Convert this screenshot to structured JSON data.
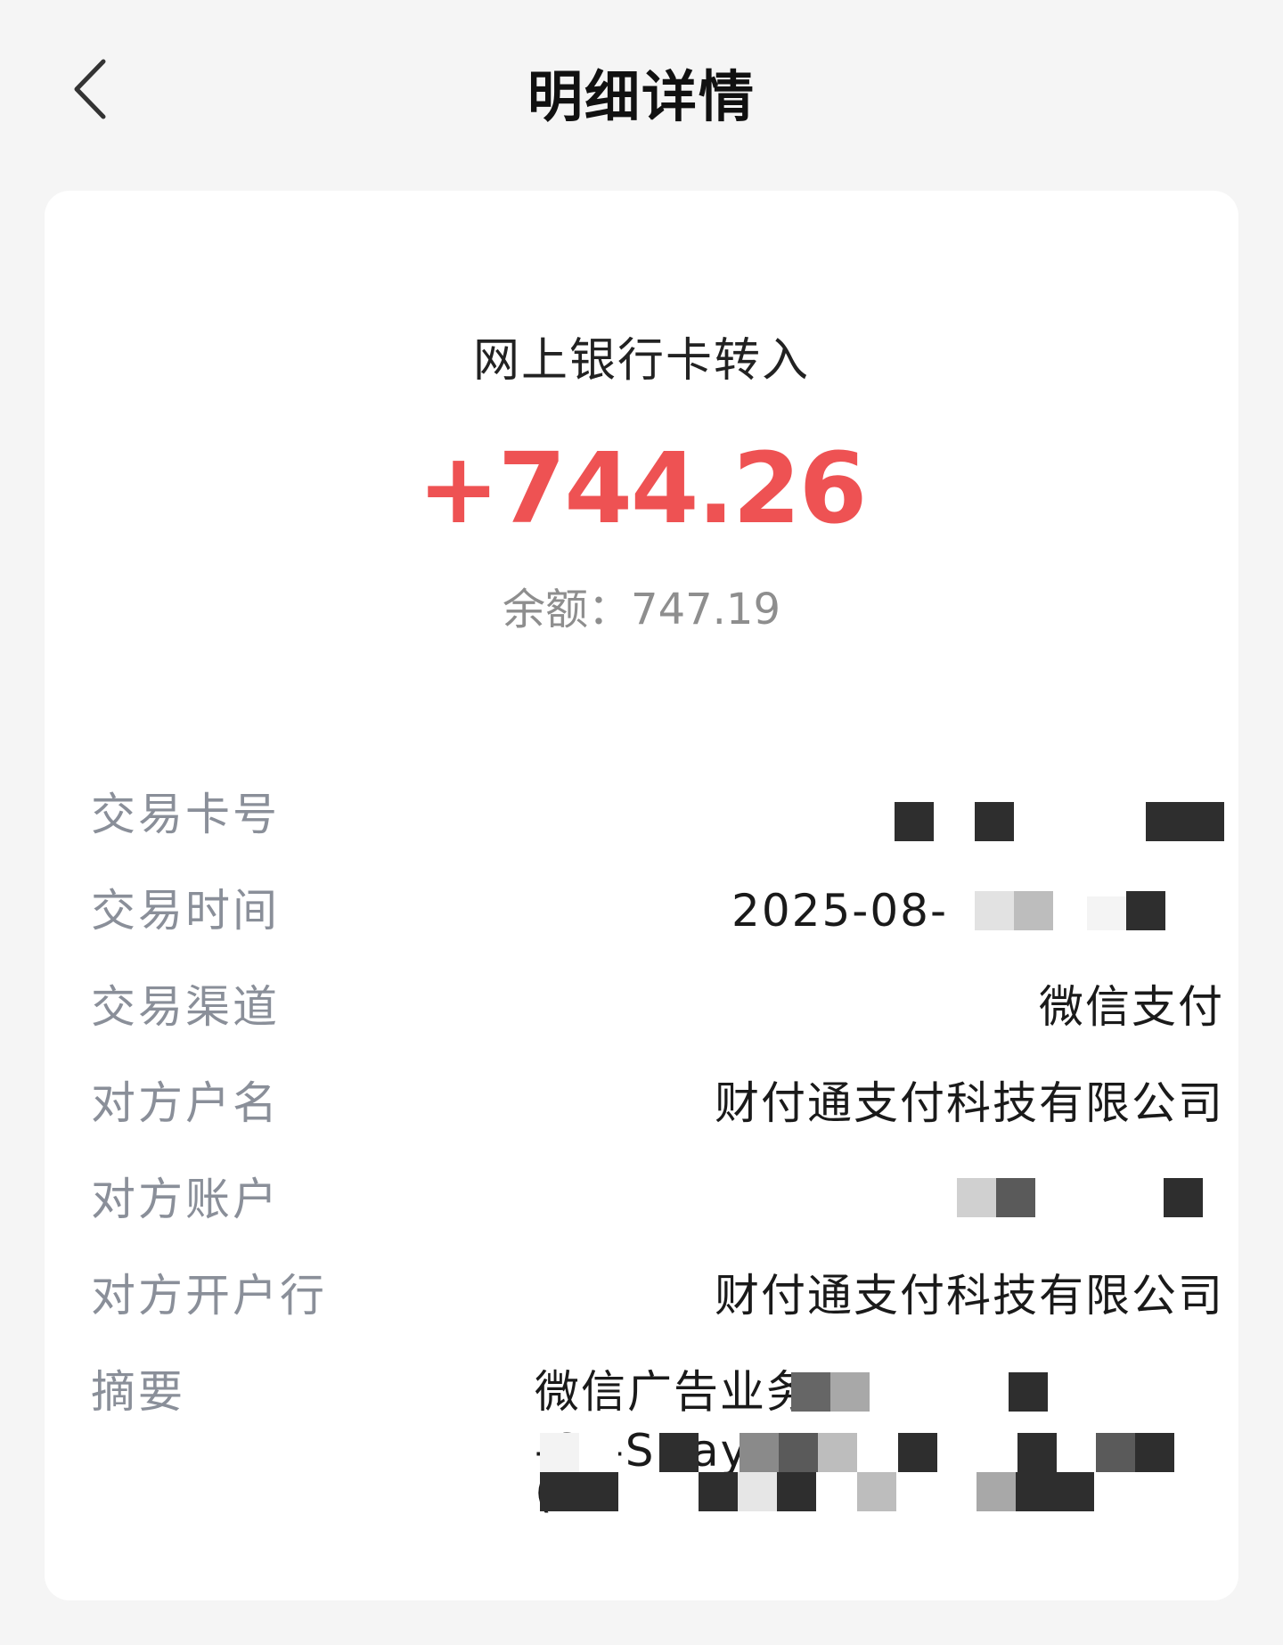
{
  "header": {
    "title": "明细详情",
    "back_icon": "chevron-left-icon"
  },
  "transaction": {
    "type": "网上银行卡转入",
    "amount": "+744.26",
    "amount_color": "#ee5253",
    "balance_label": "余额：",
    "balance_value": "747.19"
  },
  "details": {
    "card_number": {
      "label": "交易卡号",
      "value": ""
    },
    "time": {
      "label": "交易时间",
      "value": "2025-08-"
    },
    "channel": {
      "label": "交易渠道",
      "value": "微信支付"
    },
    "counterparty_name": {
      "label": "对方户名",
      "value": "财付通支付科技有限公司"
    },
    "counterparty_account": {
      "label": "对方账户",
      "value": ""
    },
    "counterparty_bank": {
      "label": "对方开户行",
      "value": "财付通支付科技有限公司"
    },
    "summary": {
      "label": "摘要",
      "line1": "微信广告业务 2",
      "line2": "-ST-SDay-F",
      "line3": "("
    }
  }
}
